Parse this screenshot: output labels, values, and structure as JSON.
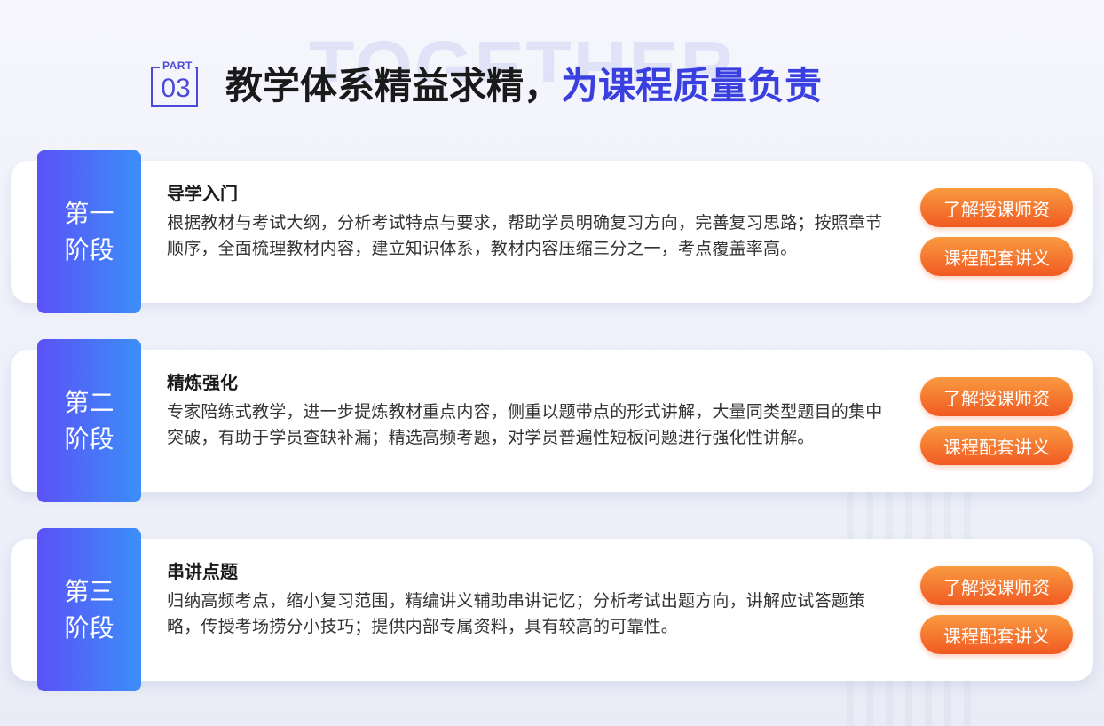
{
  "header": {
    "watermark": "TOGETHER",
    "part_label": "PART",
    "part_number": "03",
    "title_main": "教学体系精益求精，",
    "title_accent": "为课程质量负责"
  },
  "stages": [
    {
      "tag_line1": "第一",
      "tag_line2": "阶段",
      "title": "导学入门",
      "description": "根据教材与考试大纲，分析考试特点与要求，帮助学员明确复习方向，完善复习思路；按照章节顺序，全面梳理教材内容，建立知识体系，教材内容压缩三分之一，考点覆盖率高。",
      "button_teachers": "了解授课师资",
      "button_materials": "课程配套讲义"
    },
    {
      "tag_line1": "第二",
      "tag_line2": "阶段",
      "title": "精炼强化",
      "description": "专家陪练式教学，进一步提炼教材重点内容，侧重以题带点的形式讲解，大量同类型题目的集中突破，有助于学员查缺补漏；精选高频考题，对学员普遍性短板问题进行强化性讲解。",
      "button_teachers": "了解授课师资",
      "button_materials": "课程配套讲义"
    },
    {
      "tag_line1": "第三",
      "tag_line2": "阶段",
      "title": "串讲点题",
      "description": "归纳高频考点，缩小复习范围，精编讲义辅助串讲记忆；分析考试出题方向，讲解应试答题策略，传授考场捞分小技巧；提供内部专属资料，具有较高的可靠性。",
      "button_teachers": "了解授课师资",
      "button_materials": "课程配套讲义"
    }
  ]
}
